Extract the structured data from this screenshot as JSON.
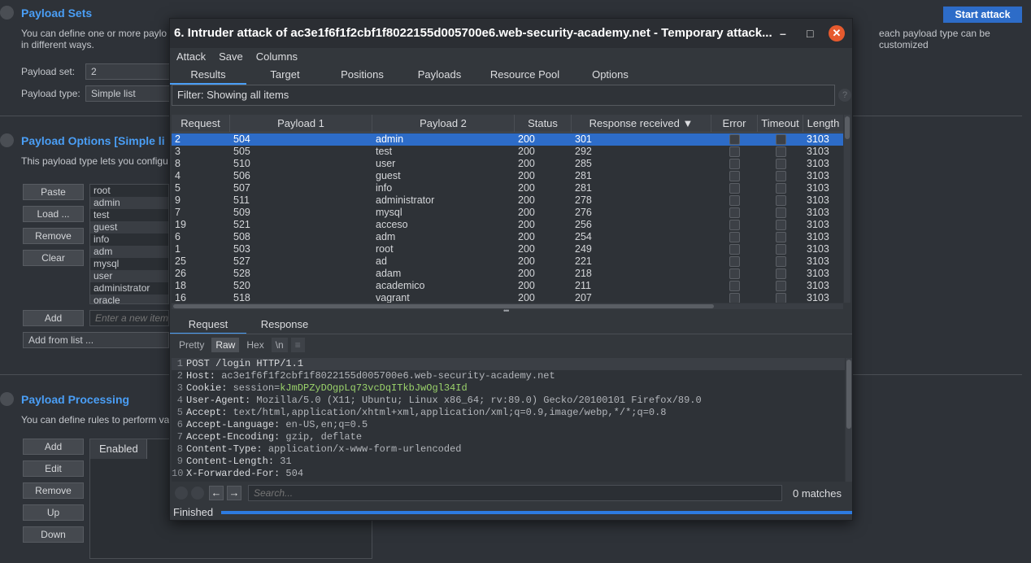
{
  "background": {
    "payload_sets": {
      "title": "Payload Sets",
      "description_left": "You can define one or more paylo",
      "description_right": "each payload type can be customized",
      "description_line2": "in different ways.",
      "payload_set_label": "Payload set:",
      "payload_set_value": "2",
      "payload_type_label": "Payload type:",
      "payload_type_value": "Simple list",
      "start_attack": "Start attack"
    },
    "payload_options": {
      "title": "Payload Options [Simple li",
      "description": "This payload type lets you configu",
      "buttons": [
        "Paste",
        "Load ...",
        "Remove",
        "Clear"
      ],
      "items": [
        "root",
        "admin",
        "test",
        "guest",
        "info",
        "adm",
        "mysql",
        "user",
        "administrator",
        "oracle"
      ],
      "add_label": "Add",
      "add_placeholder": "Enter a new item",
      "add_from_list": "Add from list ..."
    },
    "payload_processing": {
      "title": "Payload Processing",
      "description": "You can define rules to perform va",
      "buttons": [
        "Add",
        "Edit",
        "Remove",
        "Up",
        "Down"
      ],
      "column_header": "Enabled"
    }
  },
  "dialog": {
    "title": "6. Intruder attack of ac3e1f6f1f2cbf1f8022155d005700e6.web-security-academy.net - Temporary attack...",
    "minimize_glyph": "–",
    "maximize_glyph": "□",
    "close_glyph": "✕",
    "menu": [
      "Attack",
      "Save",
      "Columns"
    ],
    "tabs": [
      "Results",
      "Target",
      "Positions",
      "Payloads",
      "Resource Pool",
      "Options"
    ],
    "active_tab": "Results",
    "filter_text": "Filter: Showing all items",
    "help_glyph": "?",
    "columns": [
      "Request",
      "Payload 1",
      "Payload 2",
      "Status",
      "Response received ▼",
      "Error",
      "Timeout",
      "Length"
    ],
    "rows": [
      {
        "request": "2",
        "p1": "504",
        "p2": "admin",
        "status": "200",
        "resp": "301",
        "length": "3103"
      },
      {
        "request": "3",
        "p1": "505",
        "p2": "test",
        "status": "200",
        "resp": "292",
        "length": "3103"
      },
      {
        "request": "8",
        "p1": "510",
        "p2": "user",
        "status": "200",
        "resp": "285",
        "length": "3103"
      },
      {
        "request": "4",
        "p1": "506",
        "p2": "guest",
        "status": "200",
        "resp": "281",
        "length": "3103"
      },
      {
        "request": "5",
        "p1": "507",
        "p2": "info",
        "status": "200",
        "resp": "281",
        "length": "3103"
      },
      {
        "request": "9",
        "p1": "511",
        "p2": "administrator",
        "status": "200",
        "resp": "278",
        "length": "3103"
      },
      {
        "request": "7",
        "p1": "509",
        "p2": "mysql",
        "status": "200",
        "resp": "276",
        "length": "3103"
      },
      {
        "request": "19",
        "p1": "521",
        "p2": "acceso",
        "status": "200",
        "resp": "256",
        "length": "3103"
      },
      {
        "request": "6",
        "p1": "508",
        "p2": "adm",
        "status": "200",
        "resp": "254",
        "length": "3103"
      },
      {
        "request": "1",
        "p1": "503",
        "p2": "root",
        "status": "200",
        "resp": "249",
        "length": "3103"
      },
      {
        "request": "25",
        "p1": "527",
        "p2": "ad",
        "status": "200",
        "resp": "221",
        "length": "3103"
      },
      {
        "request": "26",
        "p1": "528",
        "p2": "adam",
        "status": "200",
        "resp": "218",
        "length": "3103"
      },
      {
        "request": "18",
        "p1": "520",
        "p2": "academico",
        "status": "200",
        "resp": "211",
        "length": "3103"
      },
      {
        "request": "16",
        "p1": "518",
        "p2": "vagrant",
        "status": "200",
        "resp": "207",
        "length": "3103"
      }
    ],
    "splitter_glyph": "•••",
    "lower_tabs": [
      "Request",
      "Response"
    ],
    "view_buttons": [
      "Pretty",
      "Raw",
      "Hex",
      "\\n",
      "≡"
    ],
    "active_view": "Raw",
    "request_lines": [
      {
        "num": "1",
        "key": "POST /login HTTP/1.1",
        "val": ""
      },
      {
        "num": "2",
        "key": "Host: ",
        "val": "ac3e1f6f1f2cbf1f8022155d005700e6.web-security-academy.net"
      },
      {
        "num": "3",
        "key": "Cookie: ",
        "val": "session=",
        "sess": "kJmDPZyDOgpLq73vcDqITkbJwOgl34Id"
      },
      {
        "num": "4",
        "key": "User-Agent: ",
        "val": "Mozilla/5.0 (X11; Ubuntu; Linux x86_64; rv:89.0) Gecko/20100101 Firefox/89.0"
      },
      {
        "num": "5",
        "key": "Accept: ",
        "val": "text/html,application/xhtml+xml,application/xml;q=0.9,image/webp,*/*;q=0.8"
      },
      {
        "num": "6",
        "key": "Accept-Language: ",
        "val": "en-US,en;q=0.5"
      },
      {
        "num": "7",
        "key": "Accept-Encoding: ",
        "val": "gzip, deflate"
      },
      {
        "num": "8",
        "key": "Content-Type: ",
        "val": "application/x-www-form-urlencoded"
      },
      {
        "num": "9",
        "key": "Content-Length: ",
        "val": "31"
      },
      {
        "num": "10",
        "key": "X-Forwarded-For: ",
        "val": "504"
      }
    ],
    "search_placeholder": "Search...",
    "matches": "0 matches",
    "status": "Finished",
    "progress": 1.0
  }
}
